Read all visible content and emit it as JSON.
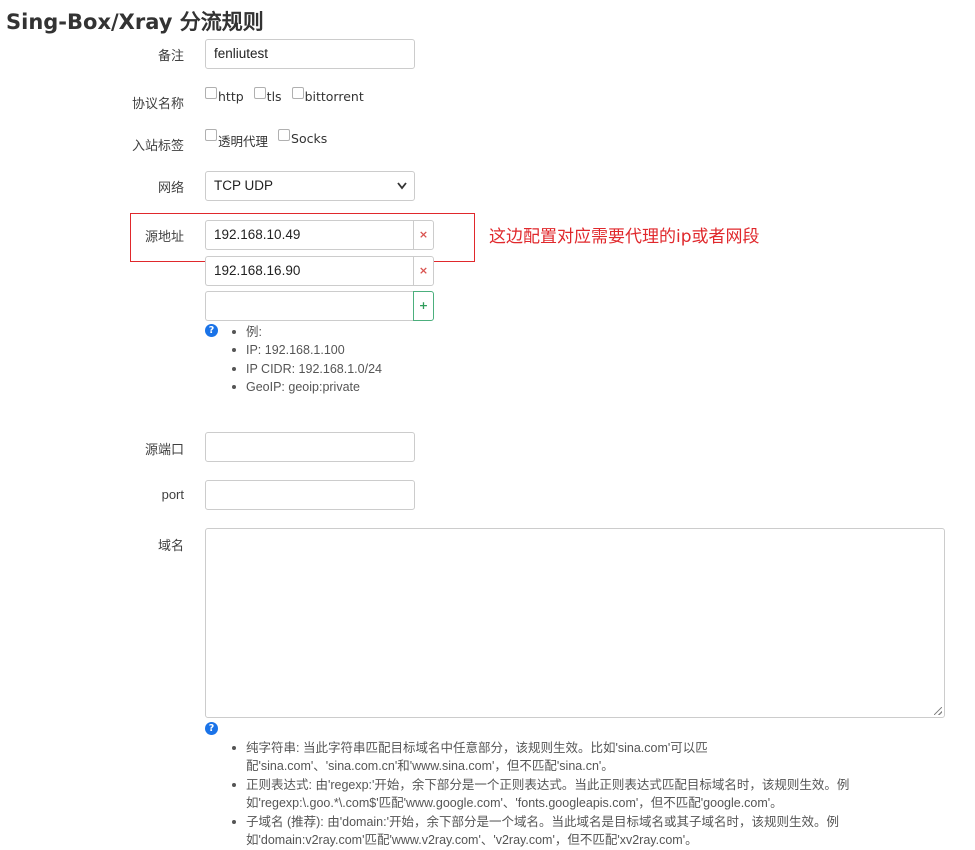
{
  "title": "Sing-Box/Xray 分流规则",
  "fields": {
    "remarks": {
      "label": "备注",
      "value": "fenliutest"
    },
    "protocol": {
      "label": "协议名称",
      "options": [
        {
          "label": "http",
          "checked": false
        },
        {
          "label": "tls",
          "checked": false
        },
        {
          "label": "bittorrent",
          "checked": false
        }
      ]
    },
    "inbound": {
      "label": "入站标签",
      "options": [
        {
          "label": "透明代理",
          "checked": false
        },
        {
          "label": "Socks",
          "checked": false
        }
      ]
    },
    "network": {
      "label": "网络",
      "value": "TCP UDP"
    },
    "source": {
      "label": "源地址",
      "values": [
        "192.168.10.49",
        "192.168.16.90",
        ""
      ],
      "remove_symbol": "×",
      "add_symbol": "+",
      "help": [
        "例:",
        "IP: 192.168.1.100",
        "IP CIDR: 192.168.1.0/24",
        "GeoIP: geoip:private"
      ]
    },
    "source_port": {
      "label": "源端口",
      "value": ""
    },
    "port": {
      "label": "port",
      "value": ""
    },
    "domain": {
      "label": "域名",
      "value": "",
      "help": [
        {
          "line1": "纯字符串: 当此字符串匹配目标域名中任意部分，该规则生效。比如'sina.com'可以匹",
          "line2": "配'sina.com'、'sina.com.cn'和'www.sina.com'，但不匹配'sina.cn'。"
        },
        {
          "line1": "正则表达式: 由'regexp:'开始，余下部分是一个正则表达式。当此正则表达式匹配目标域名时，该规则生效。例",
          "line2": "如'regexp:\\.goo.*\\.com$'匹配'www.google.com'、'fonts.googleapis.com'，但不匹配'google.com'。"
        },
        {
          "line1": "子域名 (推荐): 由'domain:'开始，余下部分是一个域名。当此域名是目标域名或其子域名时，该规则生效。例",
          "line2": "如'domain:v2ray.com'匹配'www.v2ray.com'、'v2ray.com'，但不匹配'xv2ray.com'。"
        }
      ]
    }
  },
  "annotation": "这边配置对应需要代理的ip或者网段",
  "help_icon_glyph": "?",
  "colors": {
    "annotation": "#e0282c",
    "help_icon": "#1a73e8",
    "remove": "#d9534f",
    "add": "#2e9c5a"
  }
}
